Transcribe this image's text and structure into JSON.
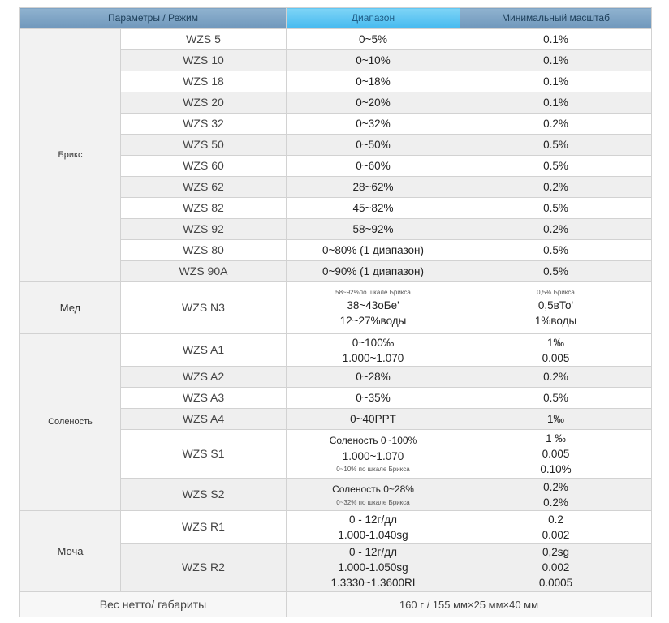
{
  "header": {
    "col1": "Параметры / Режим",
    "col2": "Диапазон",
    "col3": "Минимальный масштаб"
  },
  "groups": {
    "brix": "Брикс",
    "honey": "Мед",
    "salinity": "Соленость",
    "urine": "Моча"
  },
  "brix_rows": [
    {
      "model": "WZS 5",
      "range": "0~5%",
      "scale": "0.1%"
    },
    {
      "model": "WZS 10",
      "range": "0~10%",
      "scale": "0.1%"
    },
    {
      "model": "WZS 18",
      "range": "0~18%",
      "scale": "0.1%"
    },
    {
      "model": "WZS 20",
      "range": "0~20%",
      "scale": "0.1%"
    },
    {
      "model": "WZS 32",
      "range": "0~32%",
      "scale": "0.2%"
    },
    {
      "model": "WZS 50",
      "range": "0~50%",
      "scale": "0.5%"
    },
    {
      "model": "WZS 60",
      "range": "0~60%",
      "scale": "0.5%"
    },
    {
      "model": "WZS 62",
      "range": "28~62%",
      "scale": "0.2%"
    },
    {
      "model": "WZS 82",
      "range": "45~82%",
      "scale": "0.5%"
    },
    {
      "model": "WZS 92",
      "range": "58~92%",
      "scale": "0.2%"
    },
    {
      "model": "WZS 80",
      "range": "0~80% (1 диапазон)",
      "scale": "0.5%"
    },
    {
      "model": "WZS 90A",
      "range": "0~90% (1 диапазон)",
      "scale": "0.5%"
    }
  ],
  "honey_row": {
    "model": "WZS N3",
    "range_small": "58~92%по шкале Брикса",
    "range_2": "38~43оБе'",
    "range_3": "12~27%воды",
    "scale_small": "0,5% Брикса",
    "scale_2": "0,5вТо'",
    "scale_3": "1%воды"
  },
  "salinity_rows": {
    "a1": {
      "model": "WZS A1",
      "range_1": "0~100‰",
      "range_2": "1.000~1.070",
      "scale_1": "1‰",
      "scale_2": "0.005"
    },
    "a2": {
      "model": "WZS A2",
      "range": "0~28%",
      "scale": "0.2%"
    },
    "a3": {
      "model": "WZS A3",
      "range": "0~35%",
      "scale": "0.5%"
    },
    "a4": {
      "model": "WZS A4",
      "range": "0~40PPT",
      "scale": "1‰"
    },
    "s1": {
      "model": "WZS S1",
      "range_1": "Соленость 0~100%",
      "range_2": "1.000~1.070",
      "range_small": "0~10% по шкале Брикса",
      "scale_1": "1 ‰",
      "scale_2": "0.005",
      "scale_3": "0.10%"
    },
    "s2": {
      "model": "WZS S2",
      "range_1": "Соленость 0~28%",
      "range_small": "0~32% по шкале Брикса",
      "scale_1": "0.2%",
      "scale_2": "0.2%"
    }
  },
  "urine_rows": {
    "r1": {
      "model": "WZS R1",
      "range_1": "0 - 12г/дл",
      "range_2": "1.000-1.040sg",
      "scale_1": "0.2",
      "scale_2": "0.002"
    },
    "r2": {
      "model": "WZS R2",
      "range_1": "0 - 12г/дл",
      "range_2": "1.000-1.050sg",
      "range_3": "1.3330~1.3600RI",
      "scale_1": "0,2sg",
      "scale_2": "0.002",
      "scale_3": "0.0005"
    }
  },
  "footer": {
    "label": "Вес нетто/ габариты",
    "value": "160 г / 155 мм×25 мм×40 мм"
  }
}
